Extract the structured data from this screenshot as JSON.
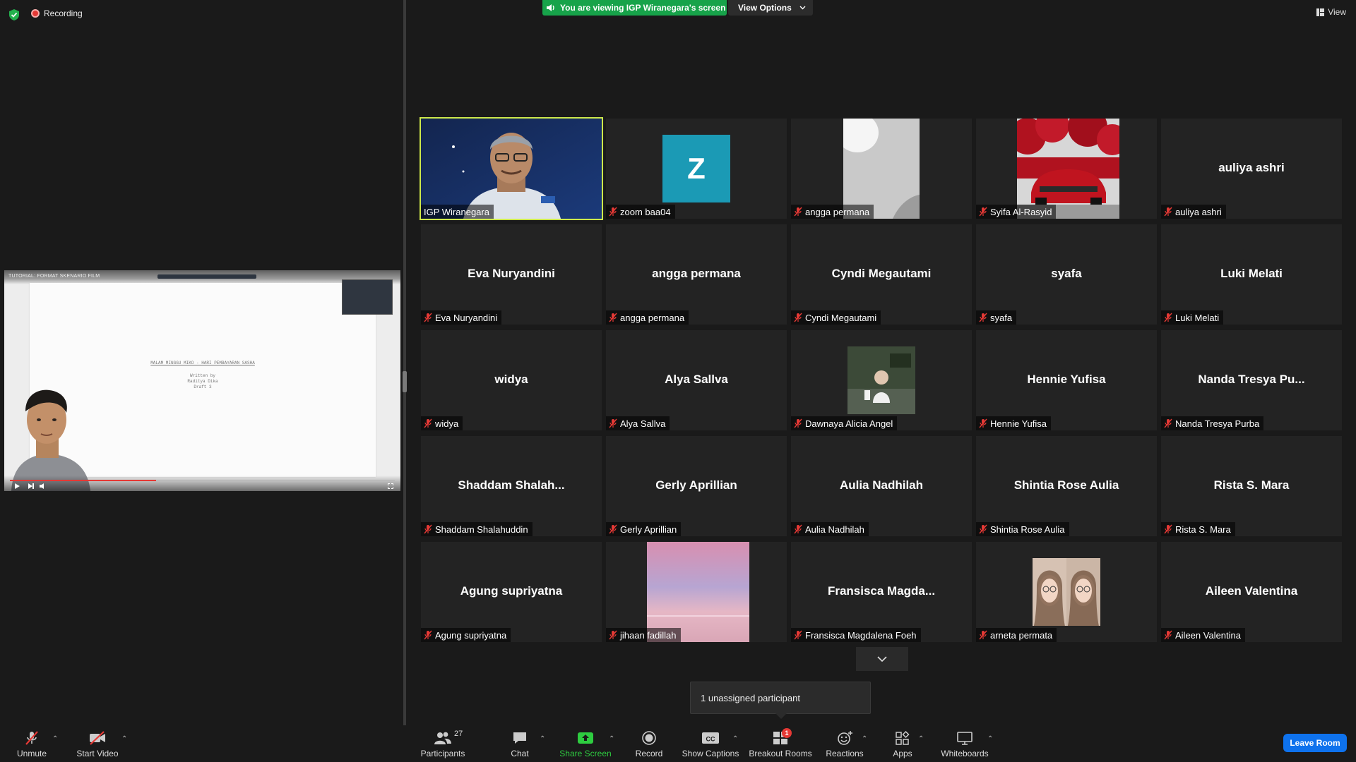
{
  "top": {
    "recording_label": "Recording",
    "viewing_banner": "You are viewing IGP Wiranegara's screen",
    "view_options_label": "View Options",
    "view_label": "View"
  },
  "shared_screen": {
    "title": "TUTORIAL: FORMAT SKENARIO FILM",
    "doc_line1": "MALAM MINGGU MIKO - HARI PEMBAYARAN SASHA",
    "doc_line2": "Written by",
    "doc_line3": "Raditya Dika",
    "doc_line4": "Draft 3",
    "progress_fraction": 0.38
  },
  "participants": [
    {
      "name": "IGP Wiranegara",
      "big": "",
      "media": "video-man",
      "active": true,
      "muted": false
    },
    {
      "name": "zoom baa04",
      "big": "",
      "media": "avatar-z",
      "avatar_letter": "Z",
      "muted": true
    },
    {
      "name": "angga permana",
      "big": "",
      "media": "photo-wall",
      "muted": true
    },
    {
      "name": "Syifa Al-Rasyid",
      "big": "",
      "media": "photo-car",
      "muted": true
    },
    {
      "name": "auliya ashri",
      "big": "auliya ashri",
      "media": "",
      "muted": true
    },
    {
      "name": "Eva Nuryandini",
      "big": "Eva Nuryandini",
      "media": "",
      "muted": true
    },
    {
      "name": "angga permana",
      "big": "angga permana",
      "media": "",
      "muted": true
    },
    {
      "name": "Cyndi Megautami",
      "big": "Cyndi Megautami",
      "media": "",
      "muted": true
    },
    {
      "name": "syafa",
      "big": "syafa",
      "media": "",
      "muted": true
    },
    {
      "name": "Luki Melati",
      "big": "Luki Melati",
      "media": "",
      "muted": true
    },
    {
      "name": "widya",
      "big": "widya",
      "media": "",
      "muted": true
    },
    {
      "name": "Alya Sallva",
      "big": "Alya Sallva",
      "media": "",
      "muted": true
    },
    {
      "name": "Dawnaya Alicia Angel",
      "big": "",
      "media": "photo-girl",
      "muted": true
    },
    {
      "name": "Hennie Yufisa",
      "big": "Hennie Yufisa",
      "media": "",
      "muted": true
    },
    {
      "name": "Nanda Tresya Purba",
      "big": "Nanda Tresya Pu...",
      "media": "",
      "muted": true
    },
    {
      "name": "Shaddam Shalahuddin",
      "big": "Shaddam  Shalah...",
      "media": "",
      "muted": true
    },
    {
      "name": "Gerly Aprillian",
      "big": "Gerly Aprillian",
      "media": "",
      "muted": true
    },
    {
      "name": "Aulia Nadhilah",
      "big": "Aulia Nadhilah",
      "media": "",
      "muted": true
    },
    {
      "name": "Shintia Rose Aulia",
      "big": "Shintia Rose Aulia",
      "media": "",
      "muted": true
    },
    {
      "name": "Rista S. Mara",
      "big": "Rista S. Mara",
      "media": "",
      "muted": true
    },
    {
      "name": "Agung supriyatna",
      "big": "Agung supriyatna",
      "media": "",
      "muted": true
    },
    {
      "name": "jihaan fadillah",
      "big": "",
      "media": "photo-sky",
      "muted": true
    },
    {
      "name": "Fransisca Magdalena Foeh",
      "big": "Fransisca  Magda...",
      "media": "",
      "muted": true
    },
    {
      "name": "arneta permata",
      "big": "",
      "media": "photo-twins",
      "muted": true
    },
    {
      "name": "Aileen Valentina",
      "big": "Aileen Valentina",
      "media": "",
      "muted": true
    }
  ],
  "unassigned_text": "1 unassigned participant",
  "toolbar": {
    "unmute": "Unmute",
    "start_video": "Start Video",
    "participants": "Participants",
    "participants_count": "27",
    "chat": "Chat",
    "share_screen": "Share Screen",
    "record": "Record",
    "show_captions": "Show Captions",
    "captions_icon_text": "CC",
    "breakout_rooms": "Breakout Rooms",
    "breakout_badge": "1",
    "reactions": "Reactions",
    "apps": "Apps",
    "whiteboards": "Whiteboards",
    "leave_room": "Leave Room"
  },
  "colors": {
    "banner_green": "#17a34a",
    "active_border": "#cde84a",
    "leave_blue": "#0e72ed",
    "mute_red": "#e53935",
    "avatar_teal": "#1b9ab5"
  }
}
